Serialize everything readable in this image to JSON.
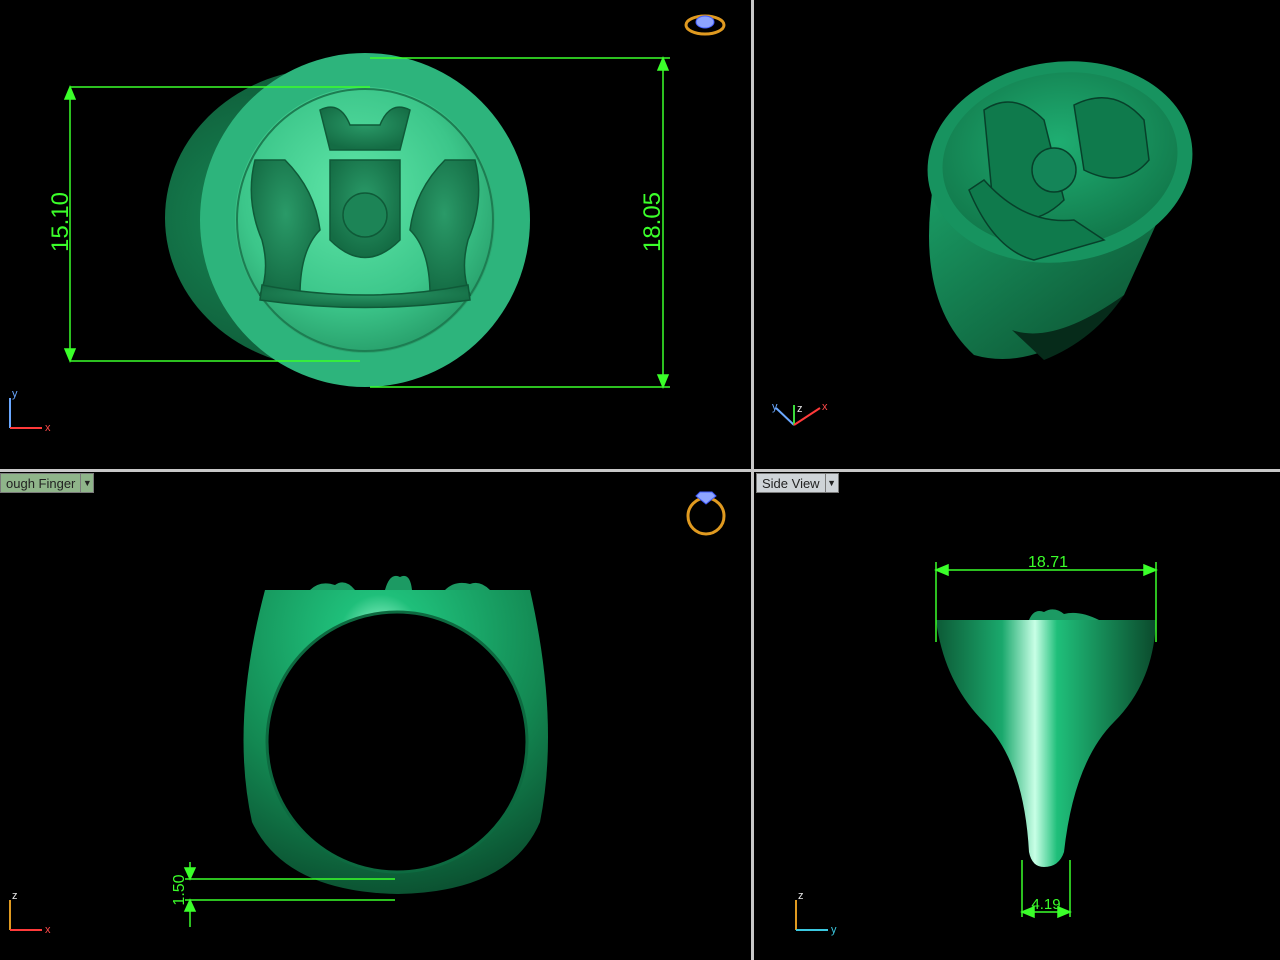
{
  "viewports": {
    "top": {
      "dim_left": "15.10",
      "dim_right": "18.05",
      "axes": [
        "y",
        "x"
      ]
    },
    "perspective": {
      "axes": [
        "y",
        "z",
        "x"
      ]
    },
    "front": {
      "label": "ough Finger",
      "dim_thickness": "1.50",
      "axes": [
        "z",
        "x"
      ]
    },
    "side": {
      "label": "Side View",
      "dim_top_width": "18.71",
      "dim_bottom_width": "4.19",
      "axes": [
        "z",
        "y"
      ]
    }
  },
  "colors": {
    "ring_green": "#1a9e6a",
    "dimension_green": "#3bff2a",
    "nav_gold": "#e09a20",
    "divider": "#c8c8c8"
  },
  "icons": [
    "ring-top-icon",
    "ring-front-icon",
    "dropdown-arrow-icon"
  ]
}
